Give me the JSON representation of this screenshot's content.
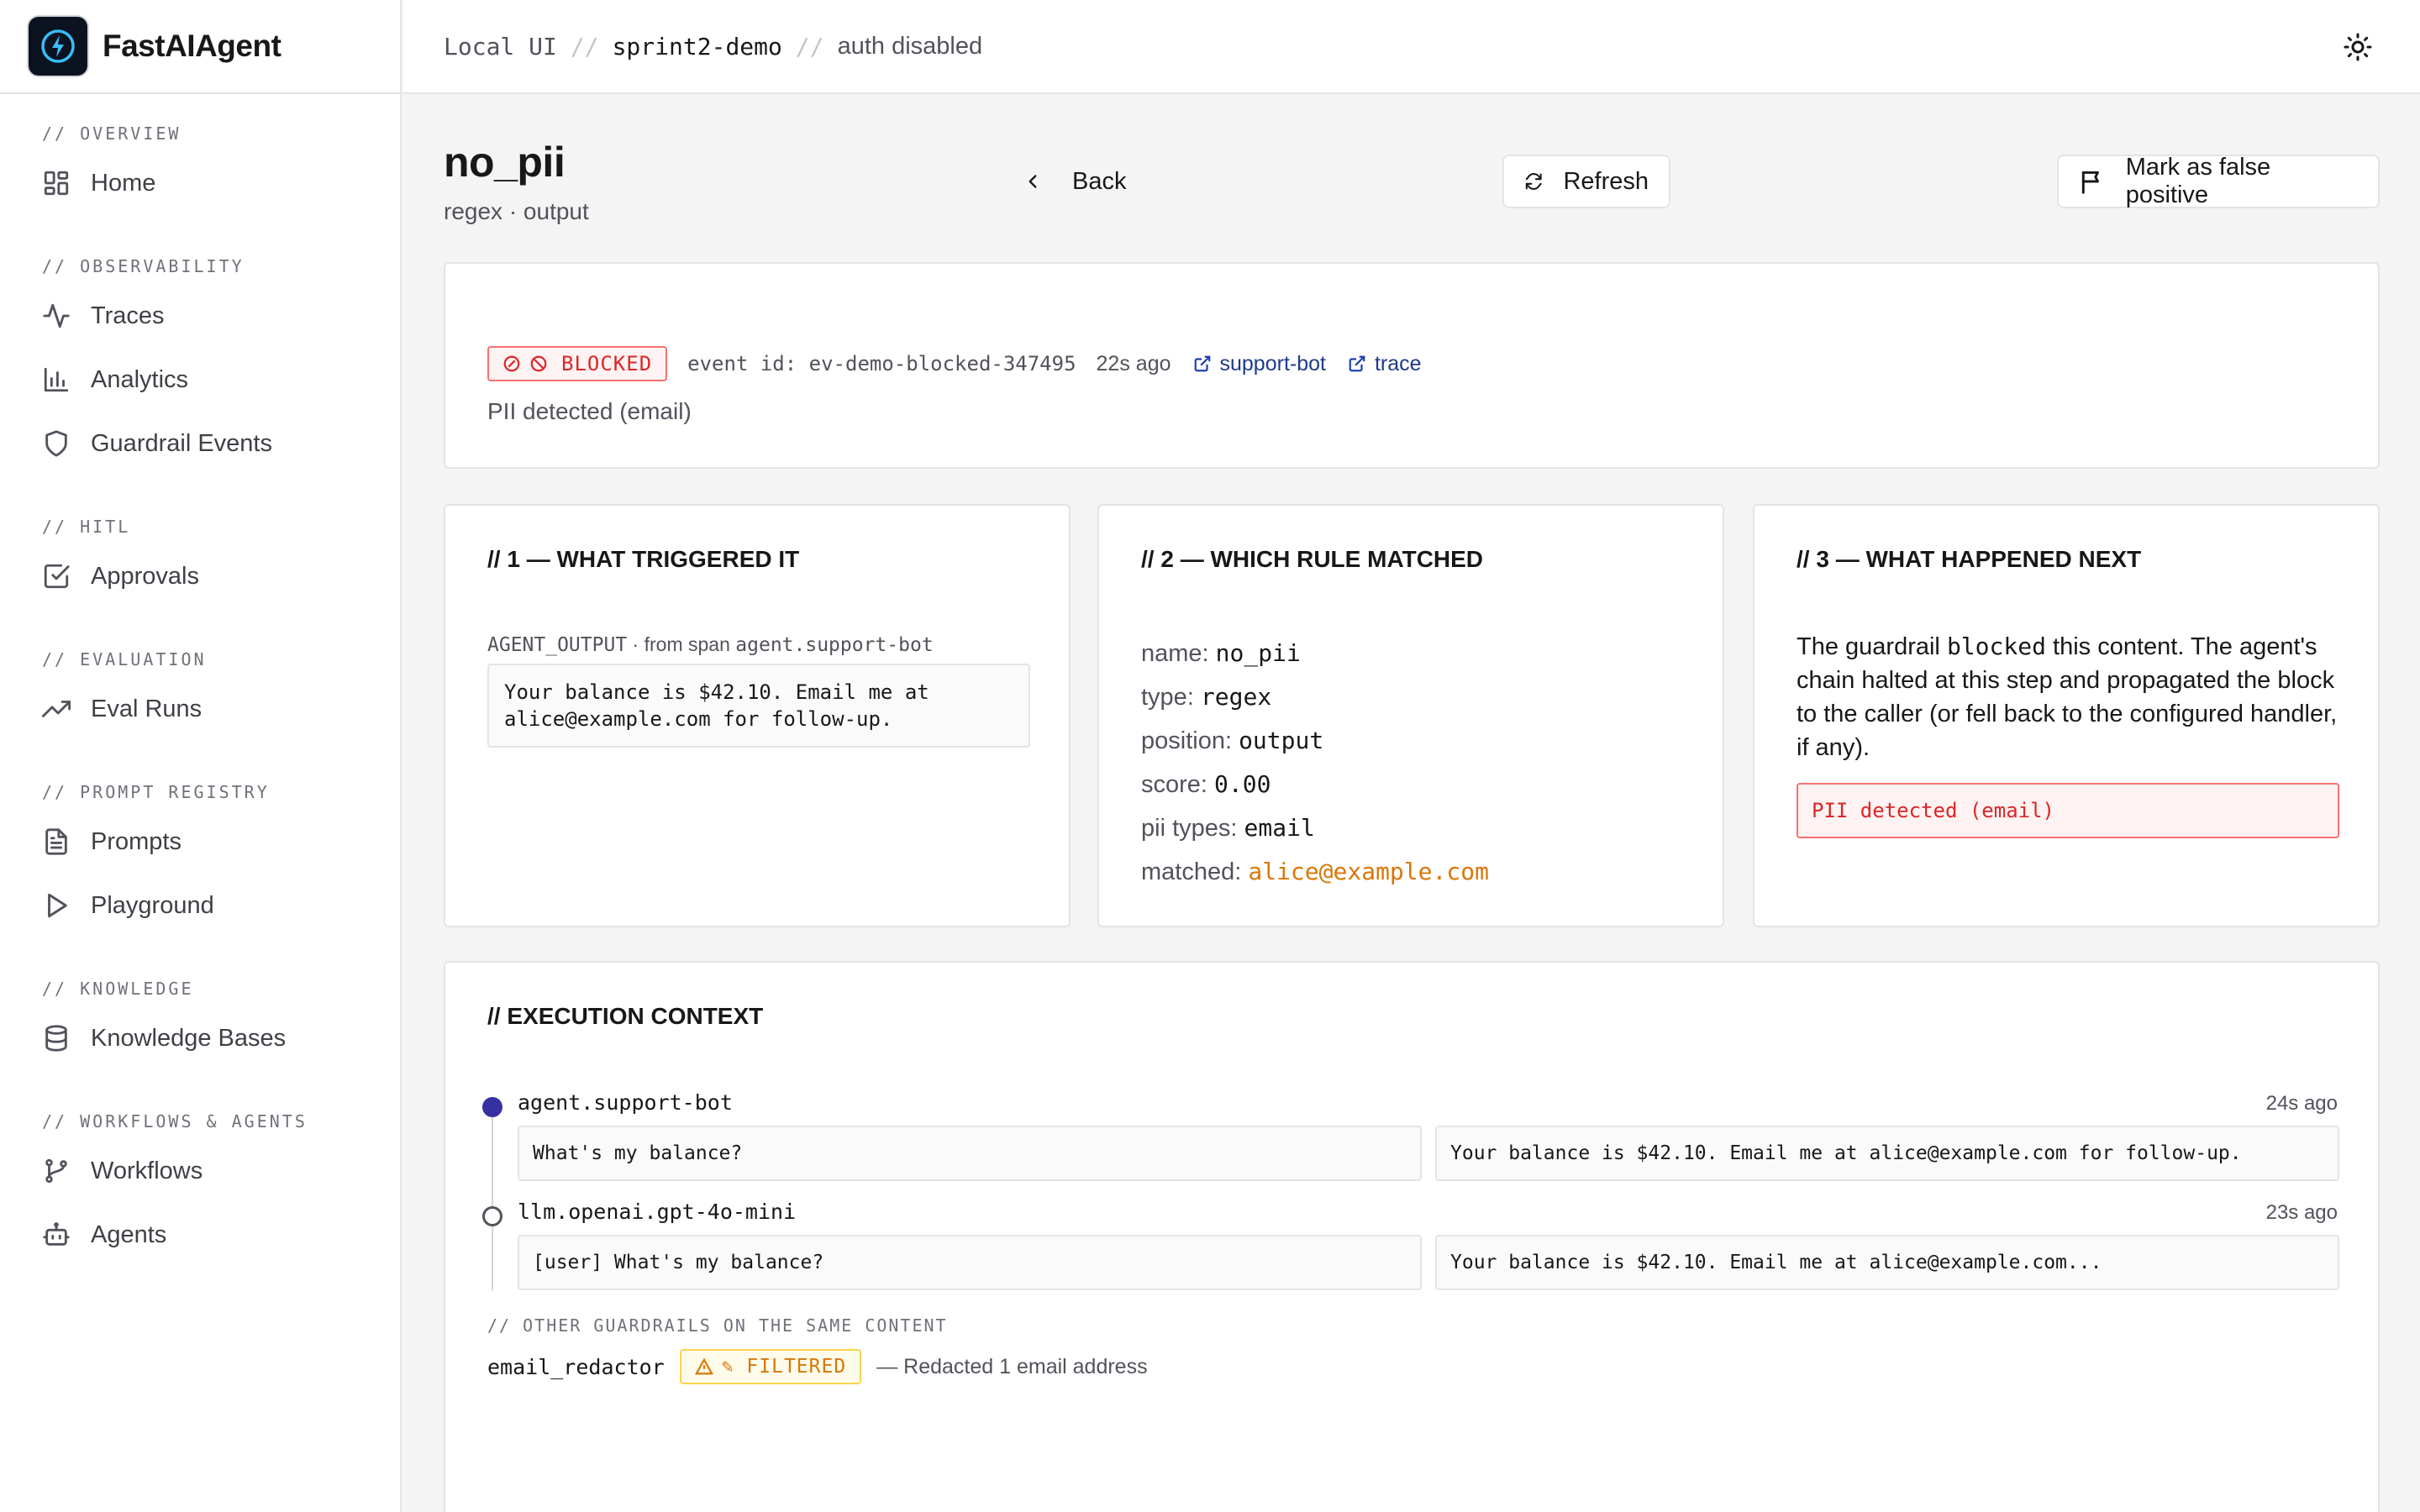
{
  "app": {
    "name": "FastAIAgent"
  },
  "breadcrumb": {
    "items": [
      "Local UI",
      "sprint2-demo",
      "auth disabled"
    ],
    "separator": "//"
  },
  "sidebar": {
    "sections": [
      {
        "label": "// OVERVIEW",
        "items": [
          {
            "label": "Home",
            "icon": "grid-icon"
          }
        ]
      },
      {
        "label": "// OBSERVABILITY",
        "items": [
          {
            "label": "Traces",
            "icon": "activity-icon"
          },
          {
            "label": "Analytics",
            "icon": "bar-chart-icon"
          },
          {
            "label": "Guardrail Events",
            "icon": "shield-icon"
          }
        ]
      },
      {
        "label": "// HITL",
        "items": [
          {
            "label": "Approvals",
            "icon": "check-square-icon"
          }
        ]
      },
      {
        "label": "// EVALUATION",
        "items": [
          {
            "label": "Eval Runs",
            "icon": "trending-up-icon"
          }
        ]
      },
      {
        "label": "// PROMPT REGISTRY",
        "items": [
          {
            "label": "Prompts",
            "icon": "file-text-icon"
          },
          {
            "label": "Playground",
            "icon": "play-icon"
          }
        ]
      },
      {
        "label": "// KNOWLEDGE",
        "items": [
          {
            "label": "Knowledge Bases",
            "icon": "database-icon"
          }
        ]
      },
      {
        "label": "// WORKFLOWS & AGENTS",
        "items": [
          {
            "label": "Workflows",
            "icon": "git-branch-icon"
          },
          {
            "label": "Agents",
            "icon": "bot-icon"
          }
        ]
      }
    ]
  },
  "header": {
    "title": "no_pii",
    "subtitle": "regex · output",
    "back_label": "Back",
    "refresh_label": "Refresh",
    "false_positive_label": "Mark as false positive"
  },
  "summary": {
    "status": "BLOCKED",
    "status_color": "#dc2626",
    "event_id": "event id: ev-demo-blocked-347495",
    "age": "22s ago",
    "agent_link": "support-bot",
    "trace_link": "trace",
    "description": "PII detected (email)"
  },
  "trigger": {
    "heading": "// 1 — WHAT TRIGGERED IT",
    "source_kind": "AGENT_OUTPUT",
    "from_text": " · from span ",
    "span": "agent.support-bot",
    "content": "Your balance is $42.10. Email me at alice@example.com for follow-up."
  },
  "rule": {
    "heading": "// 2 — WHICH RULE MATCHED",
    "fields": [
      {
        "key": "name:",
        "value": "no_pii"
      },
      {
        "key": "type:",
        "value": "regex"
      },
      {
        "key": "position:",
        "value": "output"
      },
      {
        "key": "score:",
        "value": "0.00"
      },
      {
        "key": "pii types:",
        "value": "email"
      },
      {
        "key": "matched:",
        "value": "alice@example.com"
      }
    ],
    "matched_color": "#d97706"
  },
  "outcome": {
    "heading": "// 3 — WHAT HAPPENED NEXT",
    "text_before": "The guardrail ",
    "action": "blocked",
    "text_after": " this content. The agent's chain halted at this step and propagated the block to the caller (or fell back to the configured handler, if any).",
    "message": "PII detected (email)"
  },
  "execution": {
    "heading": "// EXECUTION CONTEXT",
    "spans": [
      {
        "name": "agent.support-bot",
        "age": "24s ago",
        "input": "What's my balance?",
        "output": "Your balance is $42.10. Email me at alice@example.com for follow-up."
      },
      {
        "name": "llm.openai.gpt-4o-mini",
        "age": "23s ago",
        "input": "[user] What's my balance?",
        "output": "Your balance is $42.10. Email me at alice@example.com..."
      }
    ],
    "other_label": "// OTHER GUARDRAILS ON THE SAME CONTENT",
    "other": {
      "name": "email_redactor",
      "status": "✎ FILTERED",
      "status_color": "#d97706",
      "description": "— Redacted 1 email address"
    }
  }
}
